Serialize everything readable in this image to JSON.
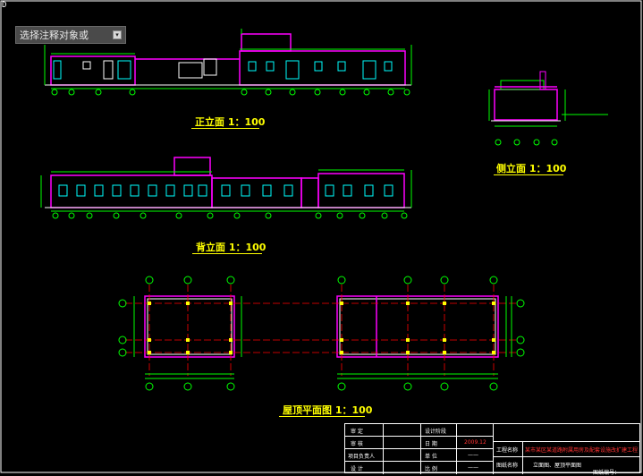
{
  "command_prompt": {
    "text": "选择注释对象或",
    "button_icon": "dropdown-arrow-icon"
  },
  "ucs_marker": "D",
  "captions": {
    "front": "正立面   1：100",
    "back": "背立面   1：100",
    "side": "侧立面   1：100",
    "roof": "屋顶平面图   1：100"
  },
  "title_block": {
    "row_labels": [
      "审    定",
      "审    核",
      "项目负责人",
      "设    计"
    ],
    "mid_labels": [
      "日    期",
      "单    位",
      "比    例"
    ],
    "top_mid": "设计阶段",
    "date_value": "2009.12",
    "project_label": "工程名称",
    "project_name": "某市某区某道路附属用房及配套设施改扩建工程",
    "drawing_label": "图纸名称",
    "drawing_name": "立面图、屋顶平面图",
    "drawing_number_label": "图纸编号："
  },
  "colors": {
    "background": "#000000",
    "wall": "#ff00ff",
    "dimension": "#00ff00",
    "caption": "#ffff00",
    "window": "#00ffff",
    "axis_line": "#ff0000"
  }
}
